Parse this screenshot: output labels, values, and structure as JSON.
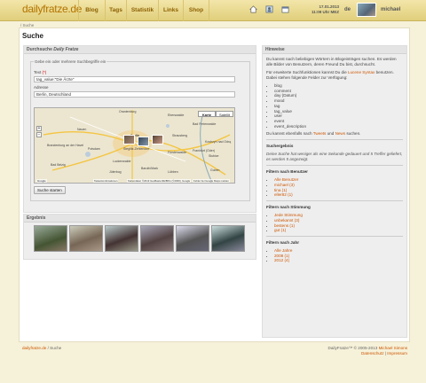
{
  "header": {
    "logo": "dailyfratze.de",
    "nav": [
      "Blog",
      "Tags",
      "Statistik",
      "Links",
      "Shop"
    ],
    "icons": [
      "home-icon",
      "portrait-icon",
      "calendar-icon"
    ],
    "date": "17.01.2013",
    "time": "11:09 Uhr MEZ",
    "lang": "de",
    "user": "michael"
  },
  "breadcrumb_top": "/ Suche",
  "page_title": "Suche",
  "search": {
    "title_prefix": "Durchsuche ",
    "title_site": "Daily Fratze",
    "legend": "Gebe ein oder mehrere Suchbegriffe ein",
    "text_label": "Text",
    "required_mark": "(*)",
    "text_value": "tag_value:\"Die Ärzte\"",
    "address_label": "Adresse",
    "address_value": "Berlin, Deutschland",
    "submit": "Suche starten",
    "map": {
      "type_map": "Karte",
      "type_sat": "Satellit",
      "labels": [
        "Oranienburg",
        "Eberswalde",
        "Bad Freienwalde",
        "Nauen",
        "Berlin",
        "Strausberg",
        "Brandenburg an der Havel",
        "Potsdam",
        "Steglitz-Zehlendorf",
        "Frankfurt (Oder)",
        "Słubice",
        "Fürstenwalde",
        "Luckenwalde",
        "Kostrzyn nad Odrą",
        "Bad Belzig",
        "Jüterbog",
        "Baruth/Mark",
        "Lübben",
        "Guben"
      ],
      "google": "Google",
      "footer_links": [
        "Tastenkombinationen",
        "Kartendaten ©2013 GeoBasis-DE/BKG (©2009), Google",
        "Fehler bei Google Maps melden"
      ]
    }
  },
  "results": {
    "title": "Ergebnis",
    "count": 6
  },
  "hints": {
    "title": "Hinweise",
    "p1": "Du kannst nach beliebigen Wörtern in Blogeinträgen suchen. Es werden alle Bilder von Benutzern, deren Freund Du bist, durchsucht.",
    "p2_a": "Für erweiterte Suchfunktionen kannst Du die ",
    "p2_link": "Lucene Syntax",
    "p2_b": " benutzen. Dabei stehen folgende Felder zur Verfügung:",
    "fields": [
      "blog",
      "comment",
      "day (Datum)",
      "mood",
      "tag",
      "tag_value",
      "user",
      "event",
      "event_description"
    ],
    "p3_a": "Du kannst ebenfalls nach ",
    "p3_link1": "Tweets",
    "p3_mid": " und ",
    "p3_link2": "News",
    "p3_b": " suchen.",
    "result_head": "Suchergebnis",
    "result_text": "Deine Suche hat weniger als eine Sekunde gedauert und 5 Treffer geliefert, es werden 5 angezeigt.",
    "user_head": "Filtern nach Benutzer",
    "user_filters": [
      "Alle Benutzer",
      "michael (3)",
      "tina (1)",
      "eller82 (1)"
    ],
    "mood_head": "Filtern nach Stimmung",
    "mood_filters": [
      "Jede Stimmung",
      "unbekannt (3)",
      "bestens (1)",
      "gut (1)"
    ],
    "year_head": "Filtern nach Jahr",
    "year_filters": [
      "Alle Jahre",
      "2008 (1)",
      "2012 (4)"
    ]
  },
  "footer": {
    "left_link": "dailyfratze.de",
    "left_rest": " / Suche",
    "right_line1_a": "DailyFratze™ © 2005-2013 ",
    "right_line1_link": "Michael Simons",
    "right_link1": "Datenschutz",
    "right_sep": " | ",
    "right_link2": "Impressum"
  },
  "colors": {
    "accent": "#cc5500",
    "logo": "#b37400",
    "bar": "#e8d88e",
    "page_bg": "#f6f1d9"
  }
}
